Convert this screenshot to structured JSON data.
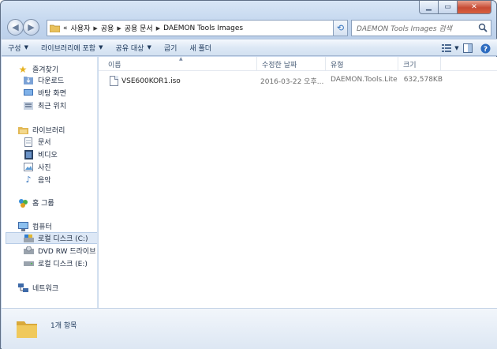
{
  "address": {
    "prefix": "«",
    "crumbs": [
      "사용자",
      "공용",
      "공용 문서",
      "DAEMON Tools Images"
    ]
  },
  "search": {
    "placeholder": "DAEMON Tools Images 검색"
  },
  "toolbar": {
    "organize": "구성",
    "include_library": "라이브러리에 포함",
    "share_with": "공유 대상",
    "burn": "굽기",
    "new_folder": "새 폴더"
  },
  "navpane": {
    "favorites": {
      "label": "즐겨찾기",
      "items": [
        "다운로드",
        "바탕 화면",
        "최근 위치"
      ]
    },
    "libraries": {
      "label": "라이브러리",
      "items": [
        "문서",
        "비디오",
        "사진",
        "음악"
      ]
    },
    "homegroup": "홈 그룹",
    "computer": {
      "label": "컴퓨터",
      "items": [
        "로컬 디스크 (C:)",
        "DVD RW 드라이브 (",
        "로컬 디스크 (E:)"
      ]
    },
    "network": "네트워크"
  },
  "columns": {
    "name": "이름",
    "date": "수정한 날짜",
    "type": "유형",
    "size": "크기"
  },
  "files": [
    {
      "name": "VSE600KOR1.iso",
      "date": "2016-03-22 오후...",
      "type": "DAEMON.Tools.Lite",
      "size": "632,578KB"
    }
  ],
  "status": {
    "count": "1개 항목"
  },
  "colors": {
    "accent": "#1e395b",
    "frame": "#c3d6ee",
    "close": "#c74b35"
  }
}
